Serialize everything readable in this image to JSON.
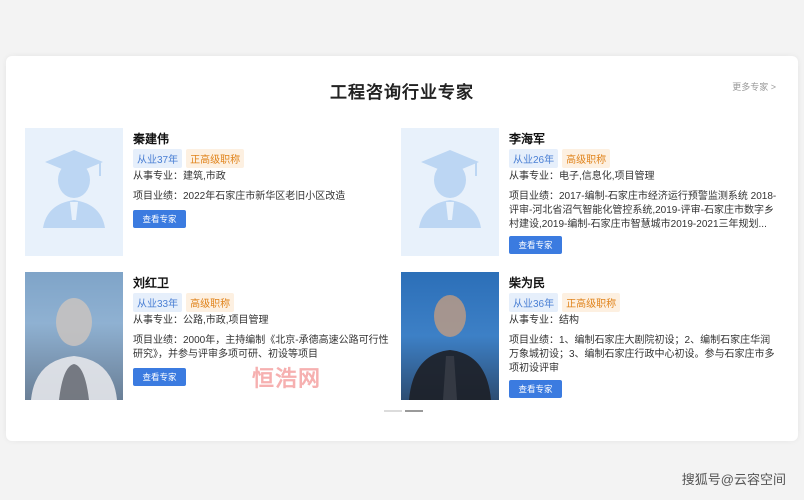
{
  "section": {
    "title": "工程咨询行业专家",
    "more_link": "更多专家 >"
  },
  "experts": [
    {
      "name": "秦建伟",
      "years": "从业37年",
      "rank": "正高级职称",
      "specialty": "从事专业：建筑,市政",
      "performance": "项目业绩：2022年石家庄市新华区老旧小区改造",
      "button": "查看专家",
      "photo": "default-avatar"
    },
    {
      "name": "李海军",
      "years": "从业26年",
      "rank": "高级职称",
      "specialty": "从事专业：电子,信息化,项目管理",
      "performance": "项目业绩：2017-编制-石家庄市经济运行预警监测系统 2018-评审-河北省沼气智能化管控系统,2019-评审-石家庄市数字乡村建设,2019-编制-石家庄市智慧城市2019-2021三年规划...",
      "button": "查看专家",
      "photo": "default-avatar"
    },
    {
      "name": "刘红卫",
      "years": "从业33年",
      "rank": "高级职称",
      "specialty": "从事专业：公路,市政,项目管理",
      "performance": "项目业绩：2000年，主持编制《北京-承德高速公路可行性研究》，并参与评审多项可研、初设等项目",
      "button": "查看专家",
      "photo": "blurred-photo"
    },
    {
      "name": "柴为民",
      "years": "从业36年",
      "rank": "正高级职称",
      "specialty": "从事专业：结构",
      "performance": "项目业绩：1、编制石家庄大剧院初设；2、编制石家庄华润万象城初设；3、编制石家庄行政中心初设。参与石家庄市多项初设评审",
      "button": "查看专家",
      "photo": "blurred-photo"
    }
  ],
  "watermark": "恒浩网",
  "footer_watermark": "搜狐号@云容空间",
  "colors": {
    "accent": "#3b7be0",
    "years_tag": "#4a7fd4",
    "rank_tag": "#e0831b"
  }
}
